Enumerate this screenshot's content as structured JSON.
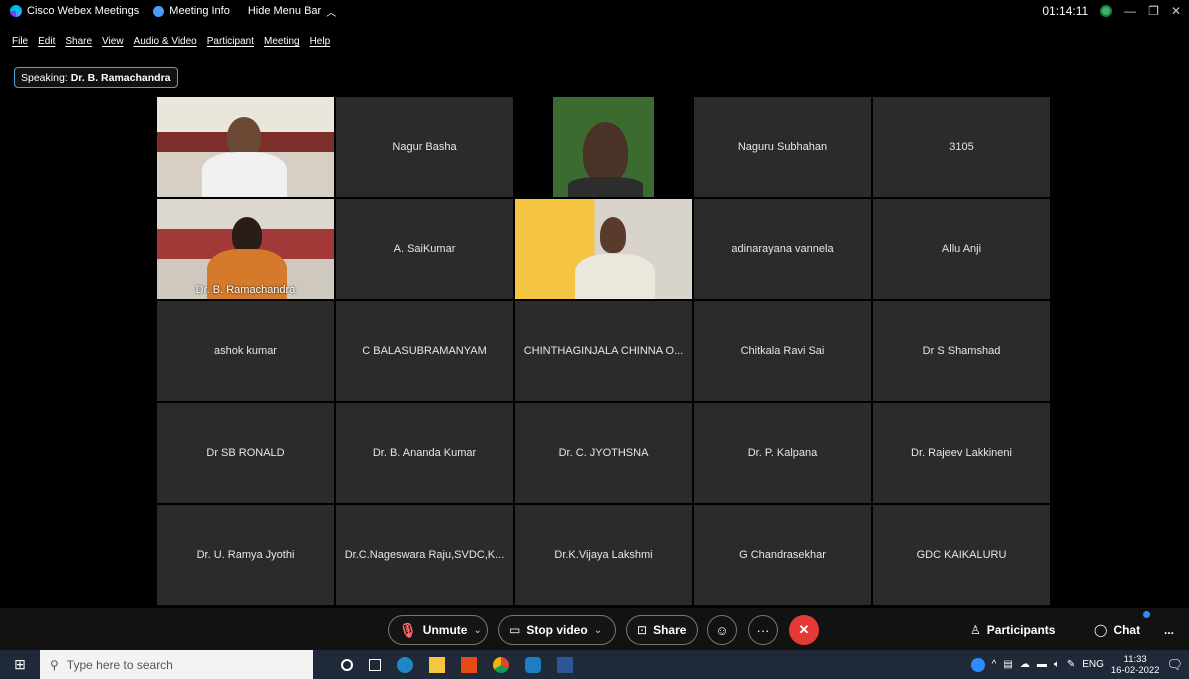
{
  "titlebar": {
    "app_title": "Cisco Webex Meetings",
    "meeting_info": "Meeting Info",
    "hide_menu": "Hide Menu Bar",
    "timer": "01:14:11"
  },
  "menu": [
    "File",
    "Edit",
    "Share",
    "View",
    "Audio & Video",
    "Participant",
    "Meeting",
    "Help"
  ],
  "speaking": {
    "label": "Speaking:",
    "name": "Dr. B. Ramachandra"
  },
  "tiles": [
    {
      "name": "",
      "video": true
    },
    {
      "name": "Nagur Basha"
    },
    {
      "name": "",
      "video": true
    },
    {
      "name": "Naguru Subhahan"
    },
    {
      "name": "3105"
    },
    {
      "name": "Dr. B. Ramachandra",
      "video": true,
      "active": true
    },
    {
      "name": "A. SaiKumar"
    },
    {
      "name": "",
      "video": true
    },
    {
      "name": "adinarayana vannela"
    },
    {
      "name": "Allu Anji"
    },
    {
      "name": "ashok kumar"
    },
    {
      "name": "C BALASUBRAMANYAM"
    },
    {
      "name": "CHINTHAGINJALA CHINNA O..."
    },
    {
      "name": "Chitkala Ravi Sai"
    },
    {
      "name": "Dr S Shamshad"
    },
    {
      "name": "Dr SB RONALD"
    },
    {
      "name": "Dr. B. Ananda Kumar"
    },
    {
      "name": "Dr. C. JYOTHSNA"
    },
    {
      "name": "Dr. P. Kalpana"
    },
    {
      "name": "Dr. Rajeev Lakkineni"
    },
    {
      "name": "Dr. U. Ramya Jyothi"
    },
    {
      "name": "Dr.C.Nageswara Raju,SVDC,K..."
    },
    {
      "name": "Dr.K.Vijaya Lakshmi"
    },
    {
      "name": "G Chandrasekhar"
    },
    {
      "name": "GDC KAIKALURU"
    }
  ],
  "controls": {
    "unmute": "Unmute",
    "stop_video": "Stop video",
    "share": "Share",
    "participants": "Participants",
    "chat": "Chat",
    "more": "..."
  },
  "taskbar": {
    "search_placeholder": "Type here to search",
    "lang": "ENG",
    "time": "11:33",
    "date": "16-02-2022"
  },
  "colors": {
    "accent": "#38b6ff",
    "end_call": "#e53935",
    "tile_bg": "#2b2b2b"
  }
}
